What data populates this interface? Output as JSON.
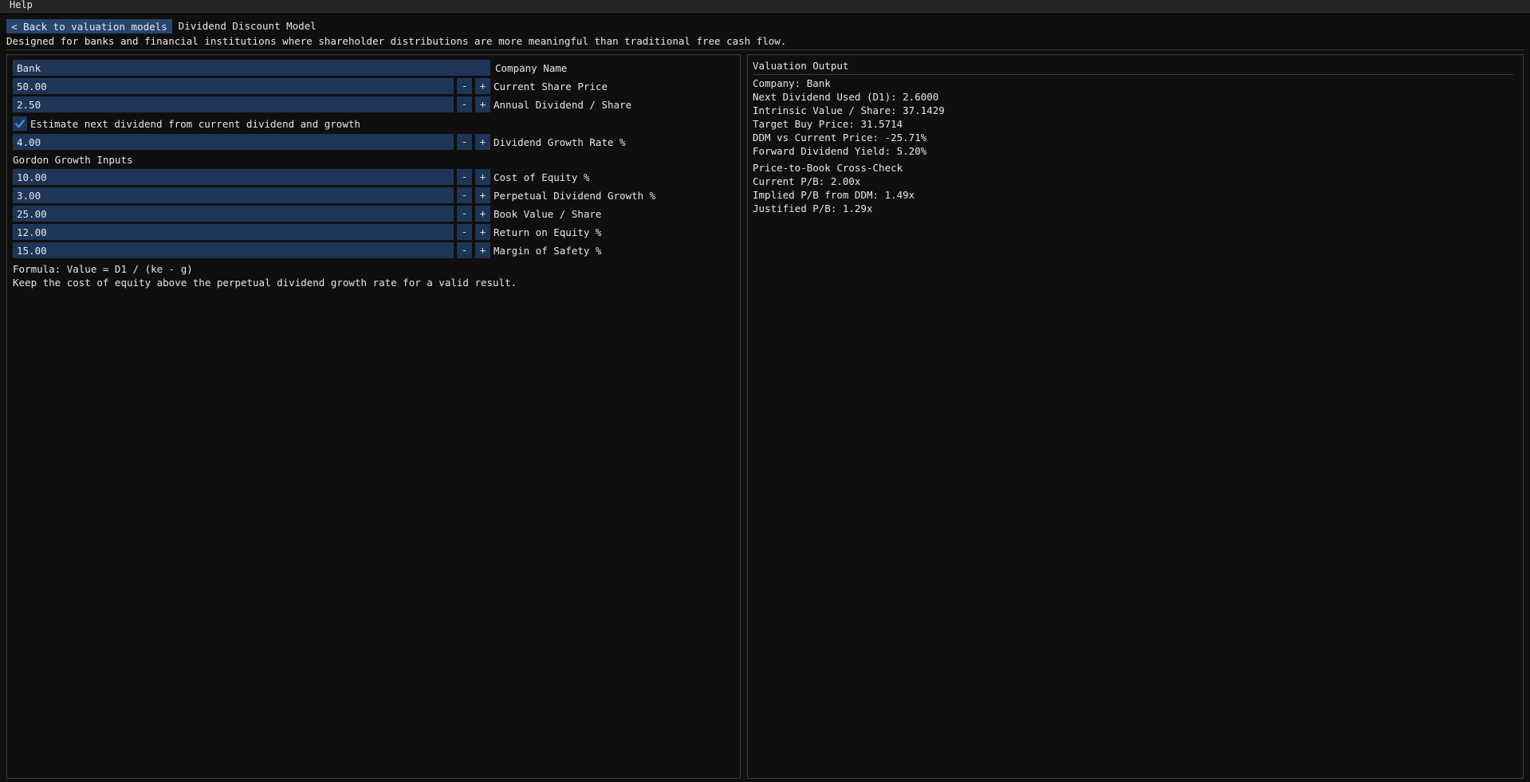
{
  "menu": {
    "help": "Help"
  },
  "header": {
    "back_label": "< Back to valuation models",
    "model_title": "Dividend Discount Model",
    "description": "Designed for banks and financial institutions where shareholder distributions are more meaningful than traditional free cash flow."
  },
  "inputs": {
    "company_name": {
      "value": "Bank",
      "label": "Company Name"
    },
    "share_price": {
      "value": "50.00",
      "label": "Current Share Price"
    },
    "annual_dividend": {
      "value": "2.50",
      "label": "Annual Dividend / Share"
    },
    "estimate_checkbox": {
      "checked": true,
      "label": "Estimate next dividend from current dividend and growth"
    },
    "growth_rate": {
      "value": "4.00",
      "label": "Dividend Growth Rate %"
    },
    "section_title": "Gordon Growth Inputs",
    "cost_of_equity": {
      "value": "10.00",
      "label": "Cost of Equity %"
    },
    "perpetual_growth": {
      "value": "3.00",
      "label": "Perpetual Dividend Growth %"
    },
    "book_value": {
      "value": "25.00",
      "label": "Book Value / Share"
    },
    "roe": {
      "value": "12.00",
      "label": "Return on Equity %"
    },
    "margin_of_safety": {
      "value": "15.00",
      "label": "Margin of Safety %"
    },
    "minus_label": "-",
    "plus_label": "+"
  },
  "notes": {
    "formula": "Formula: Value = D1 / (ke - g)",
    "hint": "Keep the cost of equity above the perpetual dividend growth rate for a valid result."
  },
  "output": {
    "title": "Valuation Output",
    "company": "Company: Bank",
    "next_dividend": "Next Dividend Used (D1): 2.6000",
    "intrinsic_value": "Intrinsic Value / Share: 37.1429",
    "target_buy": "Target Buy Price: 31.5714",
    "ddm_vs_price": "DDM vs Current Price: -25.71%",
    "forward_yield": "Forward Dividend Yield: 5.20%",
    "pb_title": "Price-to-Book Cross-Check",
    "current_pb": "Current P/B: 2.00x",
    "implied_pb": "Implied P/B from DDM: 1.49x",
    "justified_pb": "Justified P/B: 1.29x"
  },
  "colors": {
    "field_bg": "#1f3558",
    "button_bg": "#27466f",
    "check_mark": "#4d8fe0",
    "background": "#0f0f10"
  }
}
